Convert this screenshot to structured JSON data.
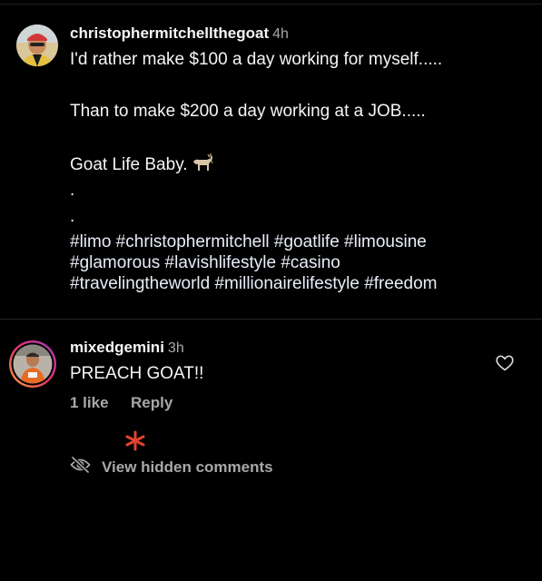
{
  "post": {
    "username": "christophermitchellthegoat",
    "time": "4h",
    "lines": [
      "I'd rather make $100 a day working for myself.....",
      "Than to make $200 a day working at a JOB.....",
      "Goat Life Baby.",
      ".",
      "."
    ],
    "emoji": "goat",
    "hashtag_lines": [
      "#limo #christophermitchell #goatlife #limousine",
      "#glamorous #lavishlifestyle #casino",
      "#travelingtheworld #millionairelifestyle #freedom"
    ]
  },
  "comment": {
    "username": "mixedgemini",
    "time": "3h",
    "text": "PREACH GOAT!!",
    "likes": "1 like",
    "reply_label": "Reply"
  },
  "hidden_comments": {
    "label": "View hidden comments",
    "icon": "eye-slash-icon"
  },
  "icons": {
    "like": "heart-icon",
    "marker": "asterisk-icon"
  },
  "colors": {
    "background": "#000000",
    "text": "#f5f5f5",
    "muted": "#a8a8a8",
    "accent_asterisk": "#e0442e"
  }
}
